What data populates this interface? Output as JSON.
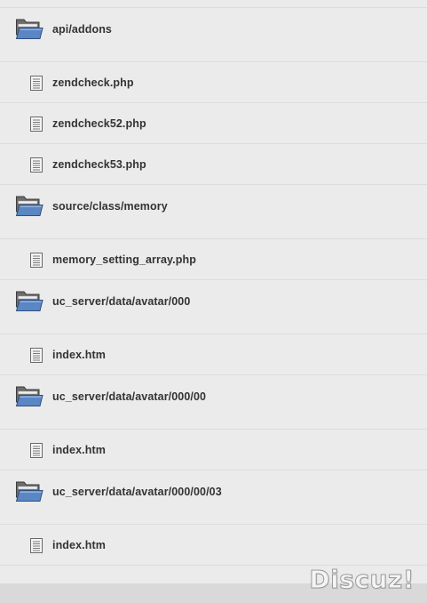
{
  "entries": [
    {
      "type": "folder",
      "label": "api/addons",
      "icon": "folder-icon"
    },
    {
      "type": "file",
      "label": "zendcheck.php",
      "icon": "file-icon"
    },
    {
      "type": "file",
      "label": "zendcheck52.php",
      "icon": "file-icon"
    },
    {
      "type": "file",
      "label": "zendcheck53.php",
      "icon": "file-icon"
    },
    {
      "type": "folder",
      "label": "source/class/memory",
      "icon": "folder-icon"
    },
    {
      "type": "file",
      "label": "memory_setting_array.php",
      "icon": "file-icon"
    },
    {
      "type": "folder",
      "label": "uc_server/data/avatar/000",
      "icon": "folder-icon"
    },
    {
      "type": "file",
      "label": "index.htm",
      "icon": "file-icon"
    },
    {
      "type": "folder",
      "label": "uc_server/data/avatar/000/00",
      "icon": "folder-icon"
    },
    {
      "type": "file",
      "label": "index.htm",
      "icon": "file-icon"
    },
    {
      "type": "folder",
      "label": "uc_server/data/avatar/000/00/03",
      "icon": "folder-icon"
    },
    {
      "type": "file",
      "label": "index.htm",
      "icon": "file-icon"
    }
  ],
  "watermark": {
    "text": "Discuz!"
  },
  "colors": {
    "background": "#ebebeb",
    "separator": "#dcdcdc",
    "text": "#333333",
    "folder_back": "#6d6d6d",
    "folder_front": "#5b86c4"
  }
}
